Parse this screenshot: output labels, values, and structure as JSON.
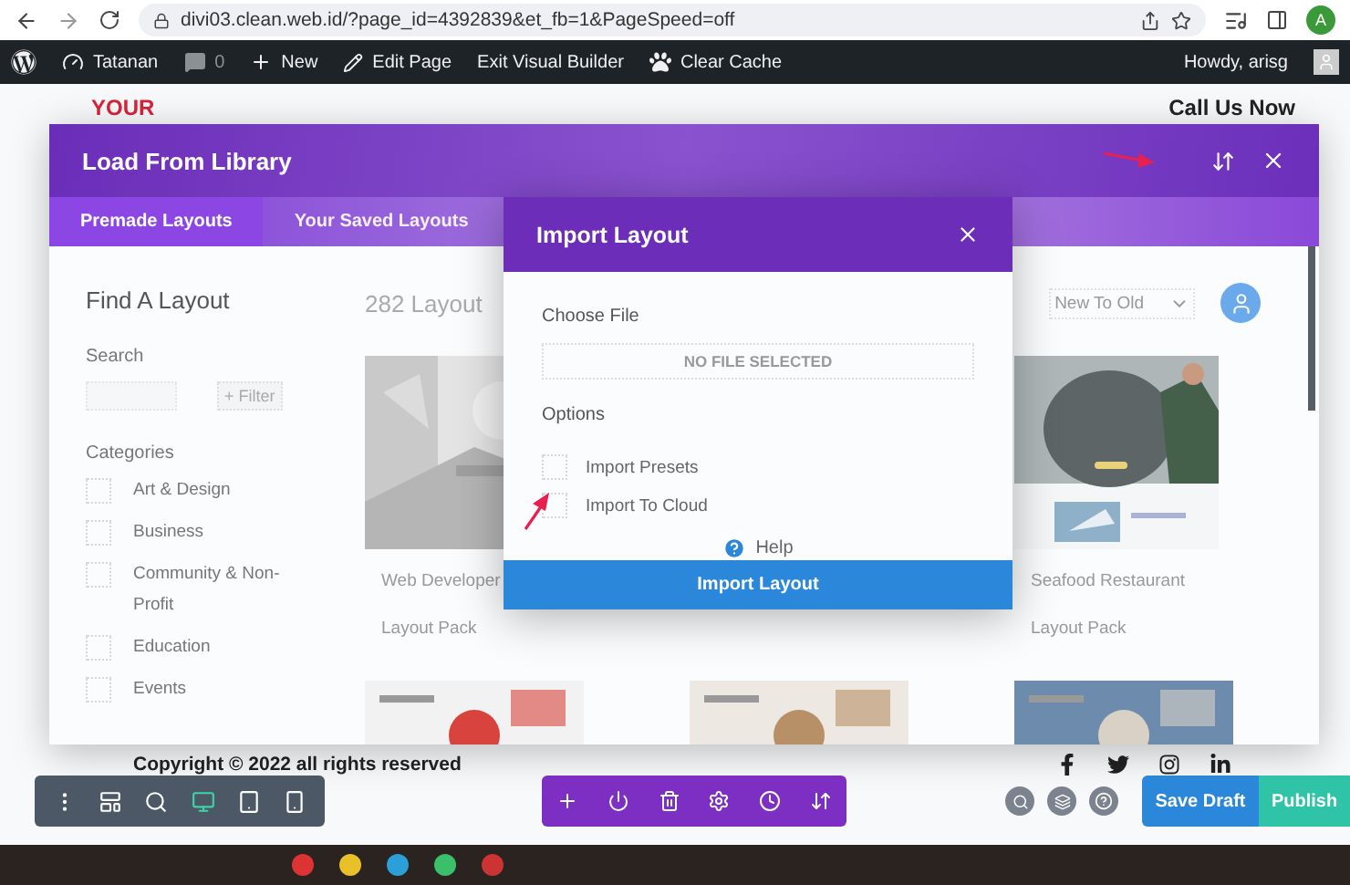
{
  "browser": {
    "url": "divi03.clean.web.id/?page_id=4392839&et_fb=1&PageSpeed=off",
    "profile_initial": "A"
  },
  "admin_bar": {
    "items": [
      {
        "kind": "logo"
      },
      {
        "kind": "site",
        "label": "Tatanan"
      },
      {
        "kind": "comments",
        "label": "0"
      },
      {
        "kind": "new",
        "label": "New"
      },
      {
        "kind": "edit",
        "label": "Edit Page"
      },
      {
        "kind": "text",
        "label": "Exit Visual Builder"
      },
      {
        "kind": "cache",
        "label": "Clear Cache"
      }
    ],
    "greeting": "Howdy, arisg"
  },
  "page": {
    "logo_text": "YOUR",
    "header_text": "Call Us Now",
    "footer_text": "Copyright © 2022 all rights reserved"
  },
  "library": {
    "title": "Load From Library",
    "tabs": [
      {
        "label": "Premade Layouts",
        "selected": true
      },
      {
        "label": "Your Saved Layouts",
        "selected": false
      }
    ],
    "sidebar": {
      "heading": "Find A Layout",
      "search_label": "Search",
      "filter": "+ Filter",
      "categories_label": "Categories",
      "categories": [
        {
          "label": "Art & Design",
          "checked": false
        },
        {
          "label": "Business",
          "checked": false
        },
        {
          "label": "Community & Non-Profit",
          "checked": false
        },
        {
          "label": "Education",
          "checked": false
        },
        {
          "label": "Events",
          "checked": false
        }
      ]
    },
    "count": "282 Layout",
    "sort": "New To Old",
    "cards": [
      {
        "title": "Web Developer",
        "subtitle": "Layout Pack"
      },
      {
        "title": "Seafood Restaurant",
        "subtitle": "Layout Pack"
      }
    ]
  },
  "import_dialog": {
    "title": "Import Layout",
    "file_label": "Choose File",
    "file_placeholder": "NO FILE SELECTED",
    "options_label": "Options",
    "options": [
      {
        "label": "Import Presets",
        "checked": false
      },
      {
        "label": "Import To Cloud",
        "checked": false
      }
    ],
    "help": "Help",
    "button": "Import Layout"
  },
  "builder": {
    "view_modes": [
      {
        "kind": "menu",
        "selected": false
      },
      {
        "kind": "wireframe",
        "selected": false
      },
      {
        "kind": "zoom",
        "selected": false
      },
      {
        "kind": "desktop",
        "selected": true
      },
      {
        "kind": "tablet",
        "selected": false
      },
      {
        "kind": "phone",
        "selected": false
      }
    ],
    "save": "Save Draft",
    "publish": "Publish"
  }
}
